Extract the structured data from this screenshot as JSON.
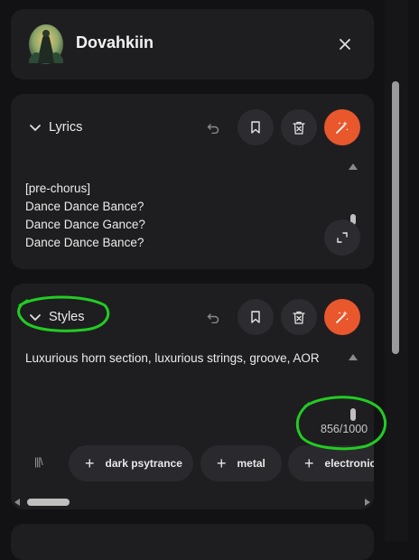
{
  "profile": {
    "name": "Dovahkiin"
  },
  "lyrics": {
    "title": "Lyrics",
    "lines": [
      "[pre-chorus]",
      "Dance Dance Bance?",
      "Dance Dance Gance?",
      "Dance Dance Bance?"
    ]
  },
  "styles": {
    "title": "Styles",
    "text": "Luxurious horn section, luxurious strings, groove, AOR",
    "counter": "856/1000",
    "chips": [
      "dark psytrance",
      "metal",
      "electronic"
    ]
  },
  "colors": {
    "accent": "#e9572d",
    "annotation": "#22cc22"
  }
}
